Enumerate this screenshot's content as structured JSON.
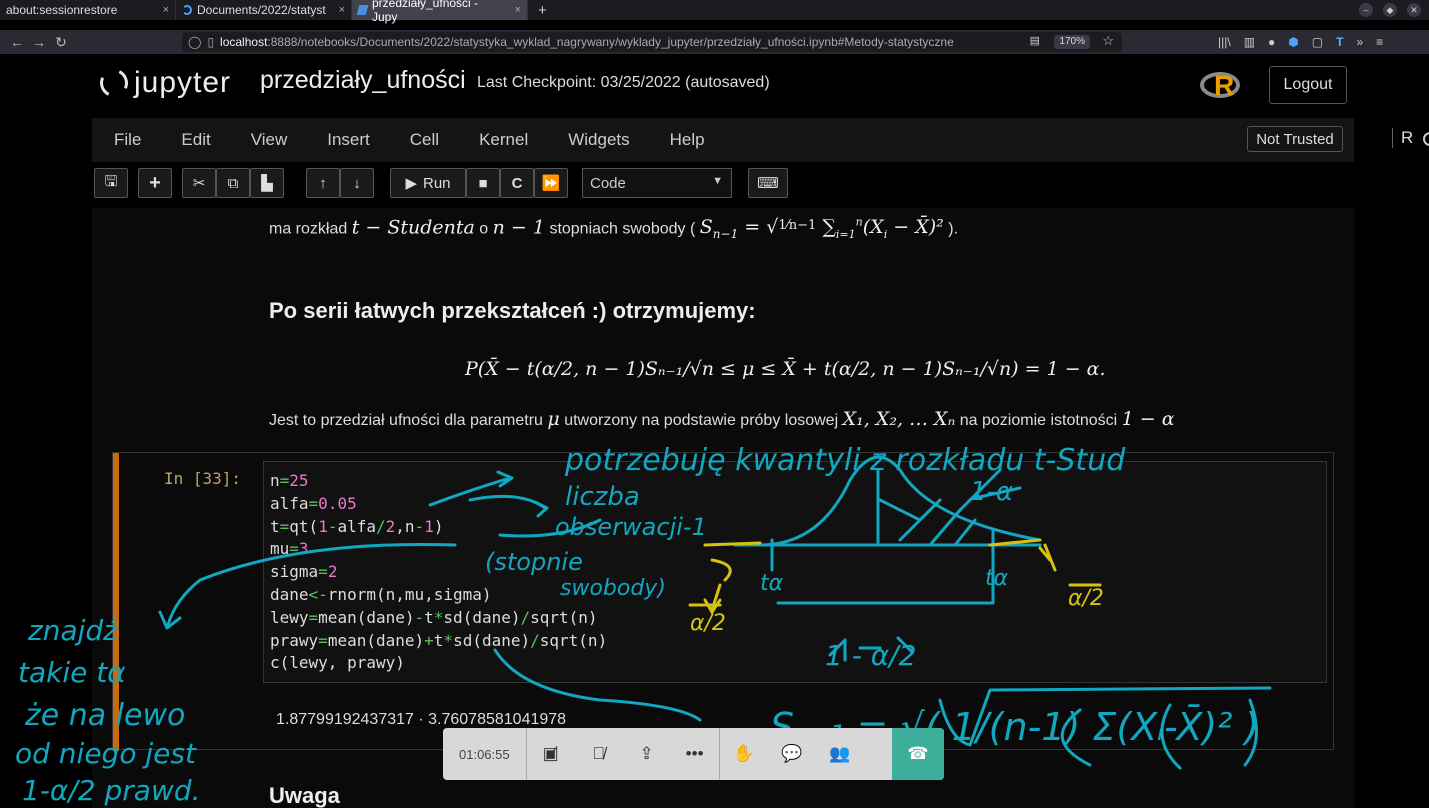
{
  "browser": {
    "tabs": [
      {
        "label": "about:sessionrestore",
        "close": "×"
      },
      {
        "label": "Documents/2022/statyst",
        "close": "×"
      },
      {
        "label": "przedziały_ufności - Jupy",
        "close": "×"
      }
    ],
    "new_tab": "+",
    "url_host": "localhost",
    "url_rest": ":8888/notebooks/Documents/2022/statystyka_wyklad_nagrywany/wyklady_jupyter/przedziały_ufności.ipynb#Metody-statystyczne",
    "zoom": "170%"
  },
  "jupyter": {
    "logo_text": "jupyter",
    "notebook_name": "przedziały_ufności",
    "checkpoint": "Last Checkpoint: 03/25/2022  (autosaved)",
    "logout": "Logout",
    "menu": [
      "File",
      "Edit",
      "View",
      "Insert",
      "Cell",
      "Kernel",
      "Widgets",
      "Help"
    ],
    "not_trusted": "Not Trusted",
    "kernel_name": "R",
    "run_label": "Run",
    "cell_type": "Code"
  },
  "notebook": {
    "line1_text_a": "ma rozkład",
    "line1_math_a": "t − Studenta",
    "line1_text_b": "o",
    "line1_math_b": "n − 1",
    "line1_text_c": "stopniach swobody (",
    "line1_math_c": "S",
    "line1_text_d": ").",
    "heading": "Po serii łatwych przekształceń :) otrzymujemy:",
    "formula": "P(X̄ − t(α/2, n − 1)Sₙ₋₁/√n ≤ μ ≤ X̄ + t(α/2, n − 1)Sₙ₋₁/√n) = 1 − α.",
    "line3_a": "Jest to przedział ufności dla parametru",
    "line3_mu": "μ",
    "line3_b": "utworzony na podstawie próby losowej",
    "line3_x": "X₁, X₂, … Xₙ",
    "line3_c": "na poziomie istotności",
    "line3_alpha": "1 − α",
    "prompt": "In [33]:",
    "output": "1.87799192437317 ·   3.76078581041978",
    "uwaga": "Uwaga"
  },
  "call": {
    "time": "01:06:55"
  },
  "annotations": {
    "a1": "potrzebuję kwantyli z rozkładu t-Stud",
    "a2": "liczba",
    "a3": "obserwacji-1",
    "a4": "(stopnie",
    "a5": "swobody)",
    "a6": "1-α",
    "a7": "tα",
    "a8": "tα",
    "a9": "1 - α/2",
    "a10": "znajdź",
    "a11": "takie tα",
    "a12": "że na lewo",
    "a13": "od niego jest",
    "a14": "1-α/2 prawd.",
    "a15": "Sₙ₋₁ = √( 1/(n-1) Σ(Xᵢ-X̄)² )",
    "a16": "α/2",
    "a17": "α/2"
  },
  "colors": {
    "cell_bar": "#c96a0e",
    "ink_teal": "#12a7c0",
    "ink_yellow": "#d6c212",
    "end_call": "#3cae9a"
  }
}
